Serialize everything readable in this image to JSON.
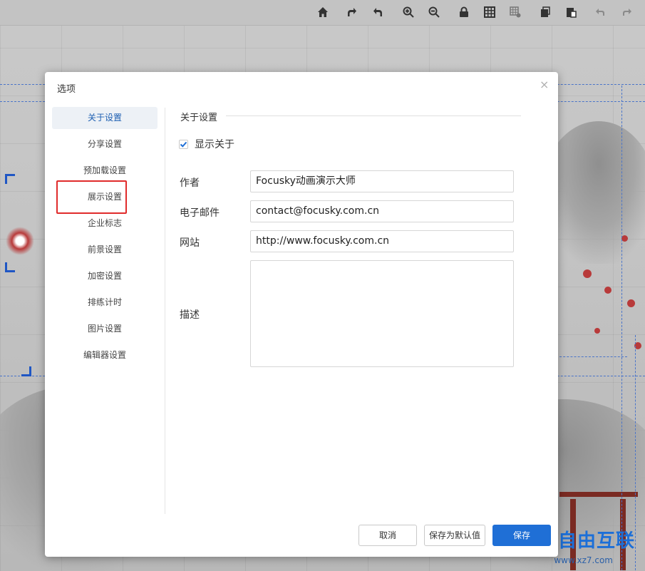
{
  "dialog": {
    "title": "选项",
    "close_icon": "close-icon"
  },
  "sidebar": {
    "items": [
      {
        "label": "关于设置",
        "active": true
      },
      {
        "label": "分享设置",
        "active": false
      },
      {
        "label": "预加载设置",
        "active": false
      },
      {
        "label": "展示设置",
        "active": false,
        "highlighted": true
      },
      {
        "label": "企业标志",
        "active": false
      },
      {
        "label": "前景设置",
        "active": false
      },
      {
        "label": "加密设置",
        "active": false
      },
      {
        "label": "排练计时",
        "active": false
      },
      {
        "label": "图片设置",
        "active": false
      },
      {
        "label": "编辑器设置",
        "active": false
      }
    ]
  },
  "about": {
    "section_title": "关于设置",
    "show_about": {
      "label": "显示关于",
      "checked": true
    },
    "author": {
      "label": "作者",
      "value": "Focusky动画演示大师"
    },
    "email": {
      "label": "电子邮件",
      "value": "contact@focusky.com.cn"
    },
    "website": {
      "label": "网站",
      "value": "http://www.focusky.com.cn"
    },
    "description": {
      "label": "描述",
      "value": ""
    }
  },
  "footer": {
    "cancel_label": "取消",
    "save_default_label": "保存为默认值",
    "save_label": "保存"
  },
  "toolbar": {
    "icons": [
      "home-icon",
      "redo-icon",
      "undo-icon",
      "zoom-in-icon",
      "zoom-out-icon",
      "lock-icon",
      "grid-icon",
      "grid-settings-icon",
      "copy-icon",
      "paste-icon",
      "back-icon",
      "forward-icon"
    ]
  },
  "watermark": {
    "text": "自由互联",
    "sub": "www.xz7.com"
  },
  "colors": {
    "accent": "#1f6fd6",
    "highlight": "#e02b2b",
    "active_bg": "#edf1f6"
  }
}
